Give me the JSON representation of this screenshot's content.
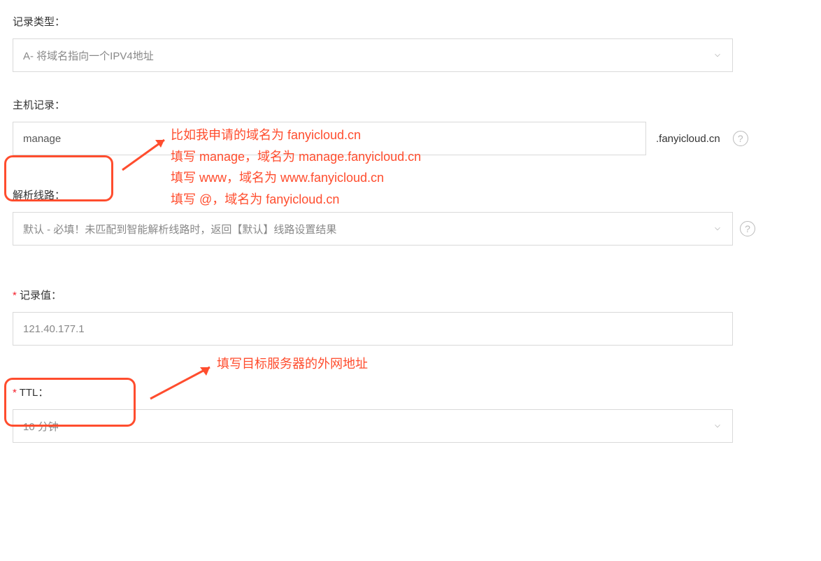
{
  "recordType": {
    "label": "记录类型：",
    "value": "A- 将域名指向一个IPV4地址"
  },
  "hostRecord": {
    "label": "主机记录：",
    "value": "manage",
    "suffix": ".fanyicloud.cn"
  },
  "dnsLine": {
    "label": "解析线路：",
    "value": "默认 - 必填！未匹配到智能解析线路时，返回【默认】线路设置结果"
  },
  "recordValue": {
    "label": "记录值：",
    "value": "121.40.177.1"
  },
  "ttl": {
    "label": "TTL：",
    "value": "10 分钟"
  },
  "annotations": {
    "host": "比如我申请的域名为 fanyicloud.cn\n填写 manage，域名为 manage.fanyicloud.cn\n填写 www，域名为 www.fanyicloud.cn\n填写 @，域名为 fanyicloud.cn",
    "value": "填写目标服务器的外网地址"
  },
  "icons": {
    "help": "?"
  }
}
